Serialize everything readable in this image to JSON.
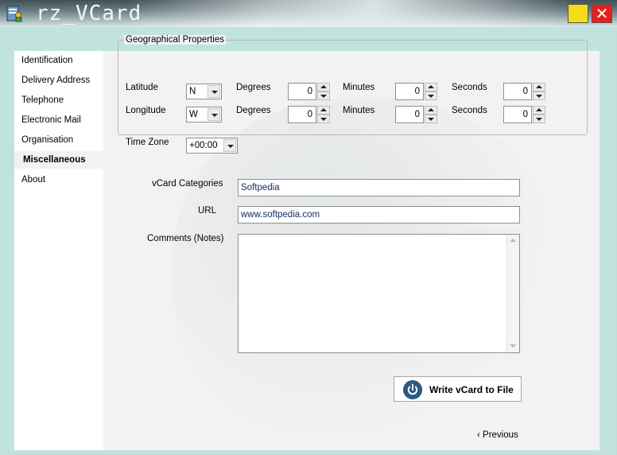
{
  "window": {
    "title": "rz_VCard",
    "close_glyph": "✕",
    "app_icon": "vcard-app-icon"
  },
  "sidebar": {
    "items": [
      {
        "label": "Identification"
      },
      {
        "label": "Delivery Address"
      },
      {
        "label": "Telephone"
      },
      {
        "label": "Electronic Mail"
      },
      {
        "label": "Organisation"
      },
      {
        "label": "Miscellaneous",
        "active": true
      },
      {
        "label": "About"
      }
    ]
  },
  "geo": {
    "legend": "Geographical Properties",
    "latitude": {
      "label": "Latitude",
      "direction": "N",
      "degrees_label": "Degrees",
      "degrees": "0",
      "minutes_label": "Minutes",
      "minutes": "0",
      "seconds_label": "Seconds",
      "seconds": "0"
    },
    "longitude": {
      "label": "Longitude",
      "direction": "W",
      "degrees_label": "Degrees",
      "degrees": "0",
      "minutes_label": "Minutes",
      "minutes": "0",
      "seconds_label": "Seconds",
      "seconds": "0"
    },
    "timezone": {
      "label": "Time Zone",
      "value": "+00:00"
    }
  },
  "form": {
    "categories_label": "vCard Categories",
    "categories_value": "Softpedia",
    "url_label": "URL",
    "url_value": "www.softpedia.com",
    "comments_label": "Comments (Notes)",
    "comments_value": ""
  },
  "actions": {
    "write_label": "Write vCard to File",
    "previous_label": "‹  Previous"
  },
  "colors": {
    "accent": "#2c5a85",
    "frame": "#c1e3de",
    "panel": "#f2f2f2",
    "minimize": "#f3dd1a",
    "close": "#e8201c"
  }
}
